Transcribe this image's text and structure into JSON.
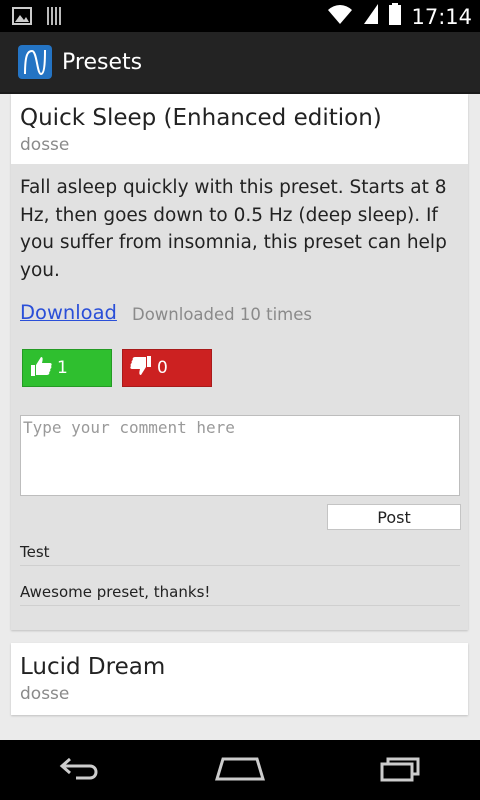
{
  "status_bar": {
    "time": "17:14",
    "left_icons": [
      "image-icon",
      "storage-icon"
    ],
    "right_icons": [
      "wifi-icon",
      "signal-icon",
      "battery-icon"
    ]
  },
  "action_bar": {
    "title": "Presets",
    "icon": "app-logo-icon"
  },
  "presets": [
    {
      "title": "Quick Sleep (Enhanced edition)",
      "author": "dosse",
      "description": "Fall asleep quickly with this preset. Starts at 8 Hz, then goes down to 0.5 Hz (deep sleep). If you suffer from insomnia, this preset can help you.",
      "download_label": "Download",
      "download_count_text": "Downloaded 10 times",
      "upvotes": "1",
      "downvotes": "0",
      "comment_placeholder": "Type your comment here",
      "post_label": "Post",
      "comments": [
        "Test",
        "Awesome preset, thanks!"
      ],
      "colors": {
        "upvote": "#2fbf2f",
        "downvote": "#cc2121",
        "link": "#2a4fd8"
      }
    },
    {
      "title": "Lucid Dream",
      "author": "dosse"
    }
  ],
  "nav_bar": {
    "buttons": [
      "back-icon",
      "home-icon",
      "recent-apps-icon"
    ]
  }
}
